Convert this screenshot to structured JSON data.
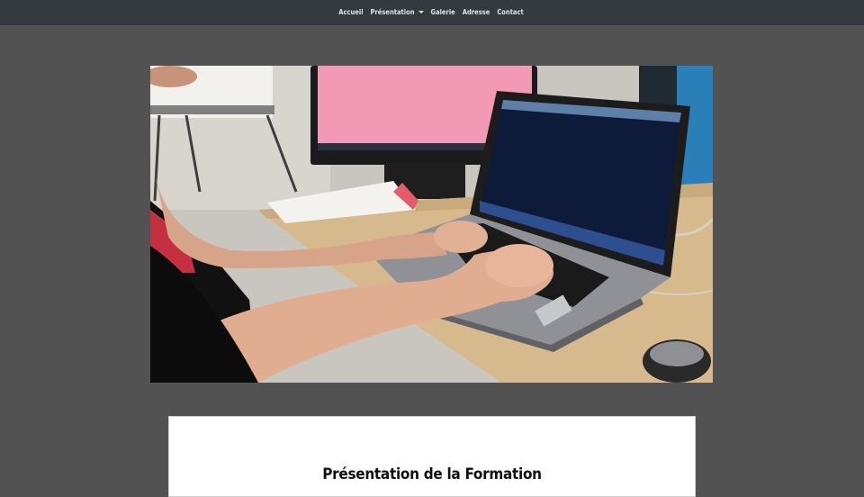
{
  "nav": {
    "items": [
      {
        "label": "Accueil"
      },
      {
        "label": "Présentation"
      },
      {
        "label": "Galerie"
      },
      {
        "label": "Adresse"
      },
      {
        "label": "Contact"
      }
    ]
  },
  "colors": {
    "navbar_bg": "#343a40",
    "page_bg": "#525252",
    "card_bg": "#ffffff"
  },
  "main": {
    "section_title": "Présentation de la Formation"
  }
}
